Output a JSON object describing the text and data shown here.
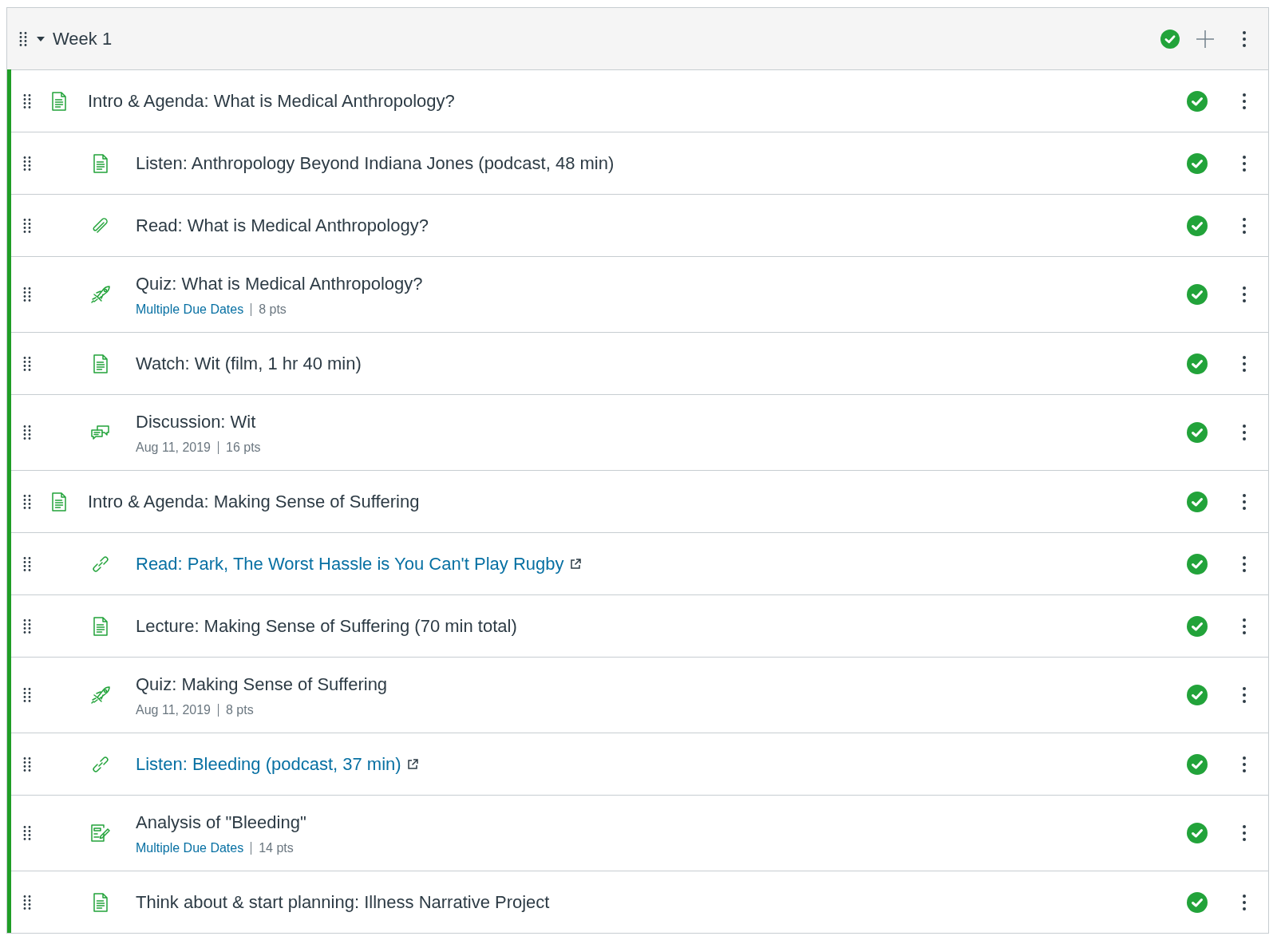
{
  "module": {
    "title": "Week 1",
    "expanded": true,
    "published": true
  },
  "items": [
    {
      "kind": "page",
      "title": "Intro & Agenda: What is Medical Anthropology?",
      "published": true,
      "children": [
        {
          "kind": "page",
          "title": "Listen: Anthropology Beyond Indiana Jones (podcast, 48 min)",
          "published": true
        },
        {
          "kind": "attachment",
          "title": "Read: What is Medical Anthropology?",
          "published": true
        },
        {
          "kind": "quiz",
          "title": "Quiz: What is Medical Anthropology?",
          "published": true,
          "due": {
            "kind": "link",
            "text": "Multiple Due Dates"
          },
          "points": "8 pts"
        },
        {
          "kind": "page",
          "title": "Watch: Wit (film, 1 hr 40 min)",
          "published": true
        },
        {
          "kind": "discussion",
          "title": "Discussion: Wit",
          "published": true,
          "due": {
            "kind": "date",
            "text": "Aug 11, 2019"
          },
          "points": "16 pts"
        }
      ]
    },
    {
      "kind": "page",
      "title": "Intro & Agenda: Making Sense of Suffering",
      "published": true,
      "children": [
        {
          "kind": "link",
          "title": "Read: Park, The Worst Hassle is You Can't Play Rugby",
          "published": true
        },
        {
          "kind": "page",
          "title": "Lecture: Making Sense of Suffering (70 min total)",
          "published": true
        },
        {
          "kind": "quiz",
          "title": "Quiz: Making Sense of Suffering",
          "published": true,
          "due": {
            "kind": "date",
            "text": "Aug 11, 2019"
          },
          "points": "8 pts"
        },
        {
          "kind": "link",
          "title": "Listen: Bleeding (podcast, 37 min)",
          "published": true
        },
        {
          "kind": "assignment",
          "title": "Analysis of \"Bleeding\"",
          "published": true,
          "due": {
            "kind": "link",
            "text": "Multiple Due Dates"
          },
          "points": "14 pts"
        },
        {
          "kind": "page",
          "title": "Think about & start planning: Illness Narrative Project",
          "published": true
        }
      ]
    }
  ]
}
